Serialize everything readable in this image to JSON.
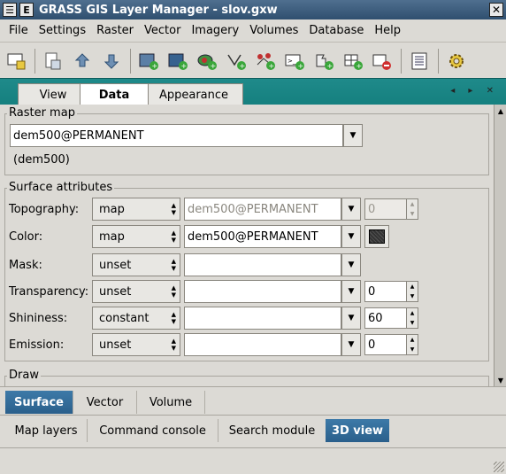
{
  "window": {
    "title": "GRASS GIS Layer Manager - slov.gxw",
    "title_glyph": "E",
    "close_glyph": "✕"
  },
  "menu": [
    "File",
    "Settings",
    "Raster",
    "Vector",
    "Imagery",
    "Volumes",
    "Database",
    "Help"
  ],
  "toolbar": {
    "icons": [
      "new-display-icon",
      "new-workspace-icon",
      "open-workspace-icon",
      "save-workspace-icon",
      "add-raster-icon",
      "add-raster-misc-icon",
      "add-vector-icon",
      "add-vector-misc-icon",
      "add-overlay-icon",
      "add-command-icon",
      "add-group-icon",
      "add-grid-icon",
      "remove-layer-icon",
      "command-list-icon",
      "settings-icon"
    ]
  },
  "notebook": {
    "tabs": [
      "View",
      "Data",
      "Appearance"
    ],
    "active": "Data",
    "nav_arrows": "◂ ▸ ✕"
  },
  "raster_map": {
    "group_label": "Raster map",
    "value": "dem500@PERMANENT",
    "caption": "(dem500)"
  },
  "surface": {
    "group_label": "Surface attributes",
    "rows": [
      {
        "label": "Topography:",
        "mode": "map",
        "map": "dem500@PERMANENT",
        "value": "0",
        "disabled": true
      },
      {
        "label": "Color:",
        "mode": "map",
        "map": "dem500@PERMANENT",
        "value": "",
        "color": "#333333"
      },
      {
        "label": "Mask:",
        "mode": "unset",
        "map": "",
        "value": ""
      },
      {
        "label": "Transparency:",
        "mode": "unset",
        "map": "",
        "value": "0"
      },
      {
        "label": "Shininess:",
        "mode": "constant",
        "map": "",
        "value": "60"
      },
      {
        "label": "Emission:",
        "mode": "unset",
        "map": "",
        "value": "0"
      }
    ]
  },
  "draw": {
    "group_label": "Draw"
  },
  "bottom_tabs_1": [
    "Surface",
    "Vector",
    "Volume"
  ],
  "bottom_tabs_2": [
    "Map layers",
    "Command console",
    "Search module",
    "3D view"
  ],
  "colors": {
    "accent_tab": "#2a5f8b",
    "notebook_bar": "#1f8a8a",
    "window_bg": "#dcdad5"
  }
}
